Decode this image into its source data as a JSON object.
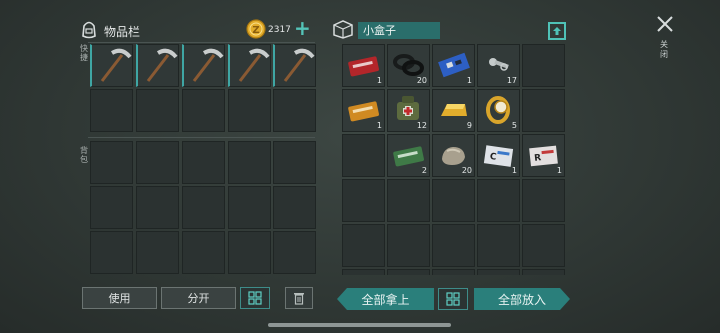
{
  "left_panel": {
    "title": "物品栏",
    "coins": "2317",
    "add_symbol": "+",
    "label_shortcut": "快捷",
    "label_backpack": "背包",
    "use_button": "使用",
    "split_button": "分开"
  },
  "right_panel": {
    "title": "小盒子",
    "take_all_button": "全部拿上",
    "put_all_button": "全部放入",
    "items": [
      {
        "name": "red-ticket-icon",
        "count": "1"
      },
      {
        "name": "tire-icon",
        "count": "20"
      },
      {
        "name": "circuit-board-icon",
        "count": "1"
      },
      {
        "name": "bolt-icon",
        "count": "17"
      },
      {
        "name": "orange-ticket-icon",
        "count": "1"
      },
      {
        "name": "first-aid-bag-icon",
        "count": "12"
      },
      {
        "name": "gold-bar-icon",
        "count": "9"
      },
      {
        "name": "gold-watch-icon",
        "count": "5"
      },
      {
        "name": "green-ticket-icon",
        "count": "2"
      },
      {
        "name": "stone-icon",
        "count": "20"
      },
      {
        "name": "c-card-icon",
        "count": "1"
      },
      {
        "name": "r-card-icon",
        "count": "1"
      }
    ]
  },
  "close_label": "关闭",
  "colors": {
    "accent": "#2a7f7b",
    "gold": "#e2ad2c"
  }
}
